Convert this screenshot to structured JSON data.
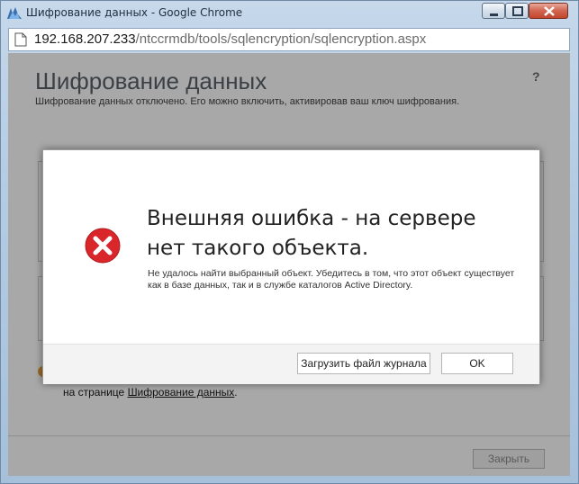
{
  "window": {
    "title": "Шифрование данных - Google Chrome",
    "url_host": "192.168.207.233",
    "url_path": "/ntccrmdb/tools/sqlencryption/sqlencryption.aspx"
  },
  "page": {
    "title": "Шифрование данных",
    "subtitle": "Шифрование данных отключено. Его можно включить, активировав ваш ключ шифрования.",
    "help": "?",
    "note_prefix": "на странице ",
    "note_link": "Шифрование данных",
    "note_suffix": ".",
    "close_button": "Закрыть"
  },
  "dialog": {
    "heading": "Внешняя ошибка - на сервере нет такого объекта.",
    "message": "Не удалось найти выбранный объект. Убедитесь в том, что этот объект существует как в базе данных, так и в службе каталогов Active Directory.",
    "download_log_button": "Загрузить файл журнала",
    "ok_button": "OK",
    "icon": "error-icon"
  },
  "colors": {
    "error_red": "#d9262a",
    "window_frame": "#b3cbe3"
  }
}
